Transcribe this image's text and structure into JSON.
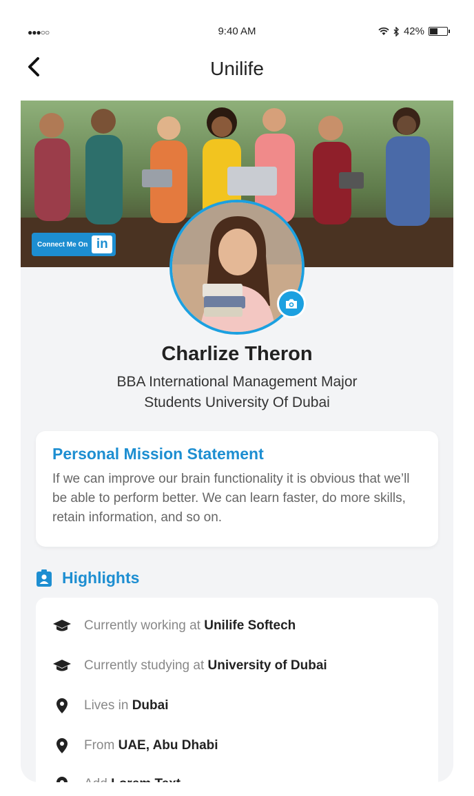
{
  "status_bar": {
    "signal": "●●●○○",
    "time": "9:40 AM",
    "battery": "42%"
  },
  "nav": {
    "back_icon": "chevron-left-icon",
    "back_glyph": "<",
    "title": "Unilife"
  },
  "profile": {
    "linkedin_label": "Connect Me On",
    "linkedin_glyph": "in",
    "name": "Charlize Theron",
    "subtitle_line1": "BBA International Management Major",
    "subtitle_line2": "Students University Of Dubai"
  },
  "mission": {
    "title": "Personal Mission Statement",
    "text": "If we can improve our brain functionality it is obvious that we’ll be able to perform better. We can learn faster, do more skills, retain information, and so on."
  },
  "highlights": {
    "title": "Highlights",
    "items": [
      {
        "icon": "graduation-cap-icon",
        "prefix": "Currently working at",
        "value": "Unilife Softech"
      },
      {
        "icon": "graduation-cap-icon",
        "prefix": "Currently studying at",
        "value": "University of Dubai"
      },
      {
        "icon": "location-pin-icon",
        "prefix": "Lives in",
        "value": "Dubai"
      },
      {
        "icon": "location-pin-icon",
        "prefix": "From",
        "value": "UAE, Abu Dhabi"
      },
      {
        "icon": "location-pin-icon",
        "prefix": "Add",
        "value": "Lorem Text"
      }
    ]
  },
  "colors": {
    "accent": "#1d8ed1",
    "avatar_ring": "#1ca0e0",
    "card_bg": "#f3f4f6"
  }
}
